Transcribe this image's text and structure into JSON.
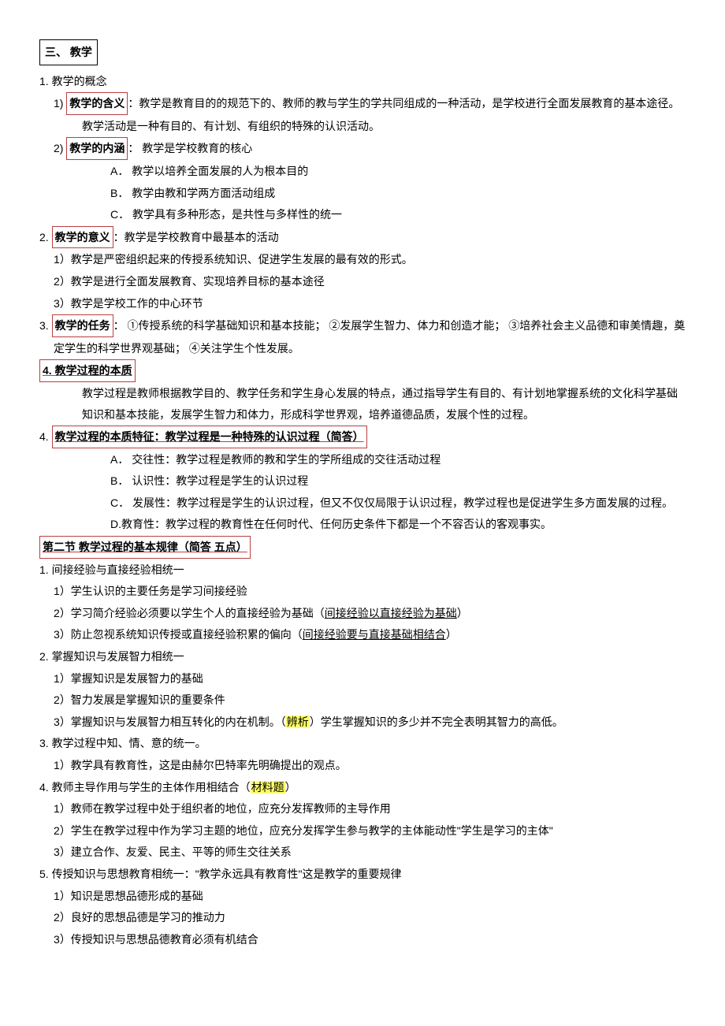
{
  "title": "三、 教学",
  "s1": {
    "h": "1. 教学的概念",
    "p1_label": "教学的含义",
    "p1_rest": "：教学是教育目的的规范下的、教师的教与学生的学共同组成的一种活动，是学校进行全面发展教育的基本途径。",
    "p1_cont": "教学活动是一种有目的、有计划、有组织的特殊的认识活动。",
    "p2_label": "教学的内涵",
    "p2_rest": "： 教学是学校教育的核心",
    "p2_a": "A． 教学以培养全面发展的人为根本目的",
    "p2_b": "B． 教学由教和学两方面活动组成",
    "p2_c": "C． 教学具有多种形态，是共性与多样性的统一"
  },
  "s2": {
    "h_label": "教学的意义",
    "h_rest": "：教学是学校教育中最基本的活动",
    "a": "1）教学是严密组织起来的传授系统知识、促进学生发展的最有效的形式。",
    "b": "2）教学是进行全面发展教育、实现培养目标的基本途径",
    "c": "3）教学是学校工作的中心环节"
  },
  "s3": {
    "h_label": "教学的任务",
    "h_rest": "： ①传授系统的科学基础知识和基本技能； ②发展学生智力、体力和创造才能； ③培养社会主义品德和审美情趣，奠",
    "h_cont": "定学生的科学世界观基础； ④关注学生个性发展。"
  },
  "s4": {
    "h": "4. 教学过程的本质",
    "p": "教学过程是教师根据教学目的、教学任务和学生身心发展的特点，通过指导学生有目的、有计划地掌握系统的文化科学基础知识和基本技能，发展学生智力和体力，形成科学世界观，培养道德品质，发展个性的过程。"
  },
  "s5": {
    "pre": "4.",
    "h": "教学过程的本质特征：教学过程是一种特殊的认识过程（简答）",
    "a": "A． 交往性：教学过程是教师的教和学生的学所组成的交往活动过程",
    "b": "B． 认识性：教学过程是学生的认识过程",
    "c": "C． 发展性：教学过程是学生的认识过程，但又不仅仅局限于认识过程，教学过程也是促进学生多方面发展的过程。",
    "d": "D.教育性：教学过程的教育性在任何时代、任何历史条件下都是一个不容否认的客观事实。"
  },
  "s6": {
    "h": "第二节 教学过程的基本规律（简答 五点）"
  },
  "r1": {
    "h": "1. 间接经验与直接经验相统一",
    "a": "1）学生认识的主要任务是学习间接经验",
    "b_pre": "2）学习简介经验必须要以学生个人的直接经验为基础（",
    "b_ul": "间接经验以直接经验为基础",
    "b_post": "）",
    "c_pre": "3）防止忽视系统知识传授或直接经验积累的偏向（",
    "c_ul": "间接经验要与直接基础相结合",
    "c_post": "）"
  },
  "r2": {
    "h": "2. 掌握知识与发展智力相统一",
    "a": "1）掌握知识是发展智力的基础",
    "b": "2）智力发展是掌握知识的重要条件",
    "c_pre": "3）掌握知识与发展智力相互转化的内在机制。（",
    "c_hl": "辨析",
    "c_post": "）学生掌握知识的多少并不完全表明其智力的高低。"
  },
  "r3": {
    "h": "3. 教学过程中知、情、意的统一。",
    "a": "1）教学具有教育性，这是由赫尔巴特率先明确提出的观点。"
  },
  "r4": {
    "h_pre": "4. 教师主导作用与学生的主体作用相结合（",
    "h_hl": "材料题",
    "h_post": "）",
    "a": "1）教师在教学过程中处于组织者的地位，应充分发挥教师的主导作用",
    "b": "2）学生在教学过程中作为学习主题的地位，应充分发挥学生参与教学的主体能动性\"学生是学习的主体\"",
    "c": "3）建立合作、友爱、民主、平等的师生交往关系"
  },
  "r5": {
    "h": "5. 传授知识与思想教育相统一：\"教学永远具有教育性\"这是教学的重要规律",
    "a": "1）知识是思想品德形成的基础",
    "b": "2）良好的思想品德是学习的推动力",
    "c": "3）传授知识与思想品德教育必须有机结合"
  }
}
